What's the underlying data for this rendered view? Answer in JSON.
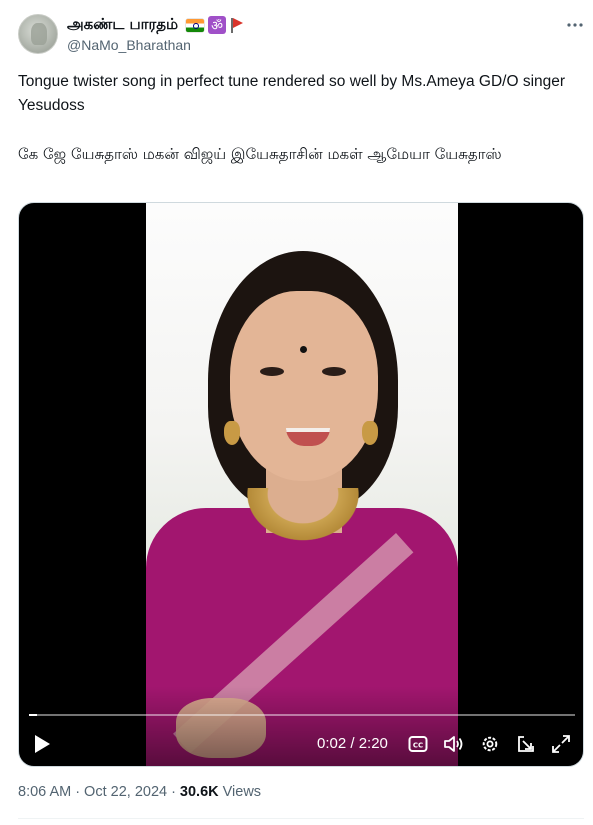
{
  "author": {
    "display_name": "அகண்ட பாரதம்",
    "handle": "@NaMo_Bharathan",
    "badges": [
      "india-flag-icon",
      "om-icon",
      "red-pennant-icon"
    ],
    "om_symbol": "ॐ"
  },
  "more_icon": "more-horizontal-icon",
  "tweet": {
    "text_english": "Tongue twister song in perfect tune rendered so well by Ms.Ameya GD/O singer Yesudoss",
    "text_tamil": "கே ஜே யேசுதாஸ் மகன் விஜய் இயேசுதாசின் மகள் ஆமேயா யேசுதாஸ்"
  },
  "video": {
    "current_time": "0:02",
    "duration": "2:20",
    "time_display": "0:02 / 2:20",
    "progress_fraction": 0.014,
    "controls": [
      "play-icon",
      "captions-icon",
      "volume-icon",
      "settings-icon",
      "pop-out-icon",
      "fullscreen-icon"
    ],
    "colors": {
      "saree": "#a2166f",
      "background": "#000000"
    }
  },
  "footer": {
    "time": "8:06 AM",
    "separator": "·",
    "date": "Oct 22, 2024",
    "views_count": "30.6K",
    "views_label": "Views"
  }
}
